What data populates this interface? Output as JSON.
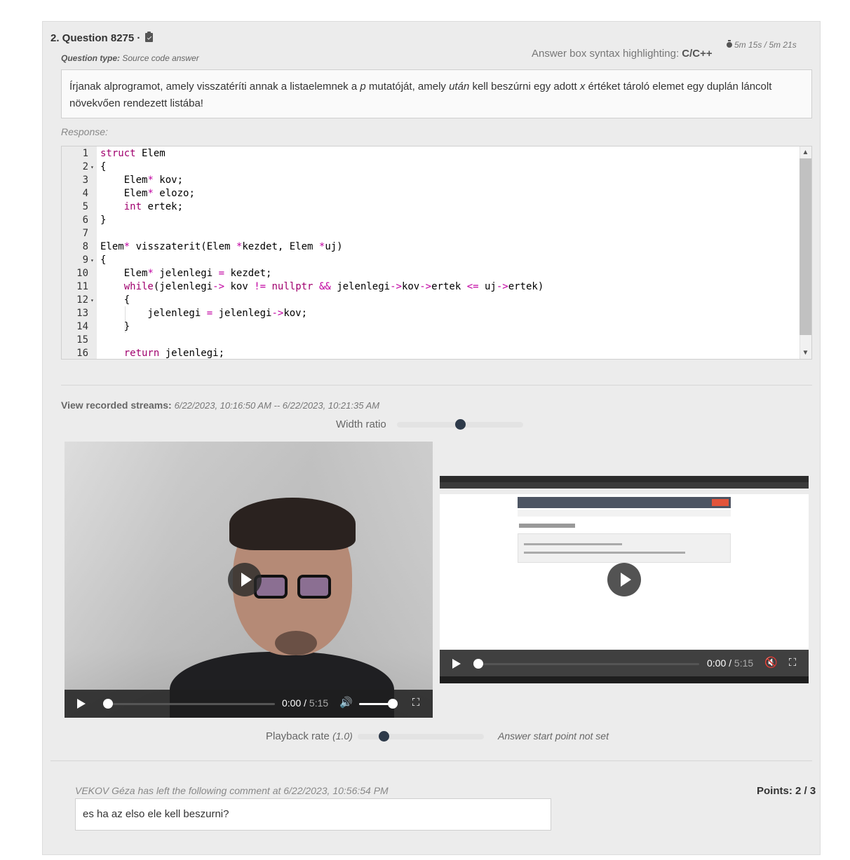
{
  "question": {
    "title": "2. Question 8275 ·",
    "type_label": "Question type:",
    "type_value": "Source code answer",
    "syntax_label": "Answer box syntax highlighting:",
    "syntax_value": "C/C++",
    "timer": "5m 15s / 5m 21s",
    "prompt_parts": [
      "Írjanak alprogramot, amely visszatéríti annak a listaelemnek a ",
      "p",
      " mutatóját, amely ",
      "után",
      " kell beszúrni egy adott ",
      "x",
      " értéket tároló elemet egy duplán láncolt növekvően rendezett listába!"
    ]
  },
  "response": {
    "label": "Response:",
    "lines": [
      {
        "num": "1",
        "fold": false,
        "html": "<span class=\"kw\">struct</span> Elem"
      },
      {
        "num": "2",
        "fold": true,
        "html": "{"
      },
      {
        "num": "3",
        "fold": false,
        "html": "    Elem<span class=\"op\">*</span> kov;"
      },
      {
        "num": "4",
        "fold": false,
        "html": "    Elem<span class=\"op\">*</span> elozo;"
      },
      {
        "num": "5",
        "fold": false,
        "html": "    <span class=\"kw\">int</span> ertek;"
      },
      {
        "num": "6",
        "fold": false,
        "html": "}"
      },
      {
        "num": "7",
        "fold": false,
        "html": ""
      },
      {
        "num": "8",
        "fold": false,
        "html": "Elem<span class=\"op\">*</span> visszaterit(Elem <span class=\"op\">*</span>kezdet, Elem <span class=\"op\">*</span>uj)"
      },
      {
        "num": "9",
        "fold": true,
        "html": "{"
      },
      {
        "num": "10",
        "fold": false,
        "html": "    Elem<span class=\"op\">*</span> jelenlegi <span class=\"op\">=</span> kezdet;"
      },
      {
        "num": "11",
        "fold": false,
        "html": "    <span class=\"kw\">while</span>(jelenlegi<span class=\"op\">-&gt;</span> kov <span class=\"op\">!=</span> <span class=\"kw\">nullptr</span> <span class=\"op\">&amp;&amp;</span> jelenlegi<span class=\"op\">-&gt;</span>kov<span class=\"op\">-&gt;</span>ertek <span class=\"op\">&lt;=</span> uj<span class=\"op\">-&gt;</span>ertek)"
      },
      {
        "num": "12",
        "fold": true,
        "html": "    {"
      },
      {
        "num": "13",
        "fold": false,
        "html": "        jelenlegi <span class=\"op\">=</span> jelenlegi<span class=\"op\">-&gt;</span>kov;"
      },
      {
        "num": "14",
        "fold": false,
        "html": "    }"
      },
      {
        "num": "15",
        "fold": false,
        "html": ""
      },
      {
        "num": "16",
        "fold": false,
        "html": "    <span class=\"kw\">return</span> jelenlegi;"
      }
    ]
  },
  "streams": {
    "label": "View recorded streams:",
    "range": "6/22/2023, 10:16:50 AM -- 6/22/2023, 10:21:35 AM",
    "width_ratio_label": "Width ratio",
    "width_ratio_value": 0.5
  },
  "videos": [
    {
      "kind": "webcam",
      "current": "0:00",
      "duration": "5:15",
      "progress": 0.0,
      "volume": 1.0
    },
    {
      "kind": "screen",
      "current": "0:00",
      "duration": "5:15",
      "progress": 0.0,
      "muted": true
    }
  ],
  "playback": {
    "label": "Playback rate",
    "rate": "(1.0)",
    "slider_value": 0.18,
    "start_note": "Answer start point not set"
  },
  "comment": {
    "header": "VEKOV Géza has left the following comment at 6/22/2023, 10:56:54 PM",
    "text": "es ha az elso ele kell beszurni?",
    "points": "Points: 2 / 3"
  },
  "colors": {
    "slider_knob": "#2e3a4a",
    "keyword": "#a0006e",
    "operator": "#c000a0",
    "logout": "#e2543b"
  }
}
